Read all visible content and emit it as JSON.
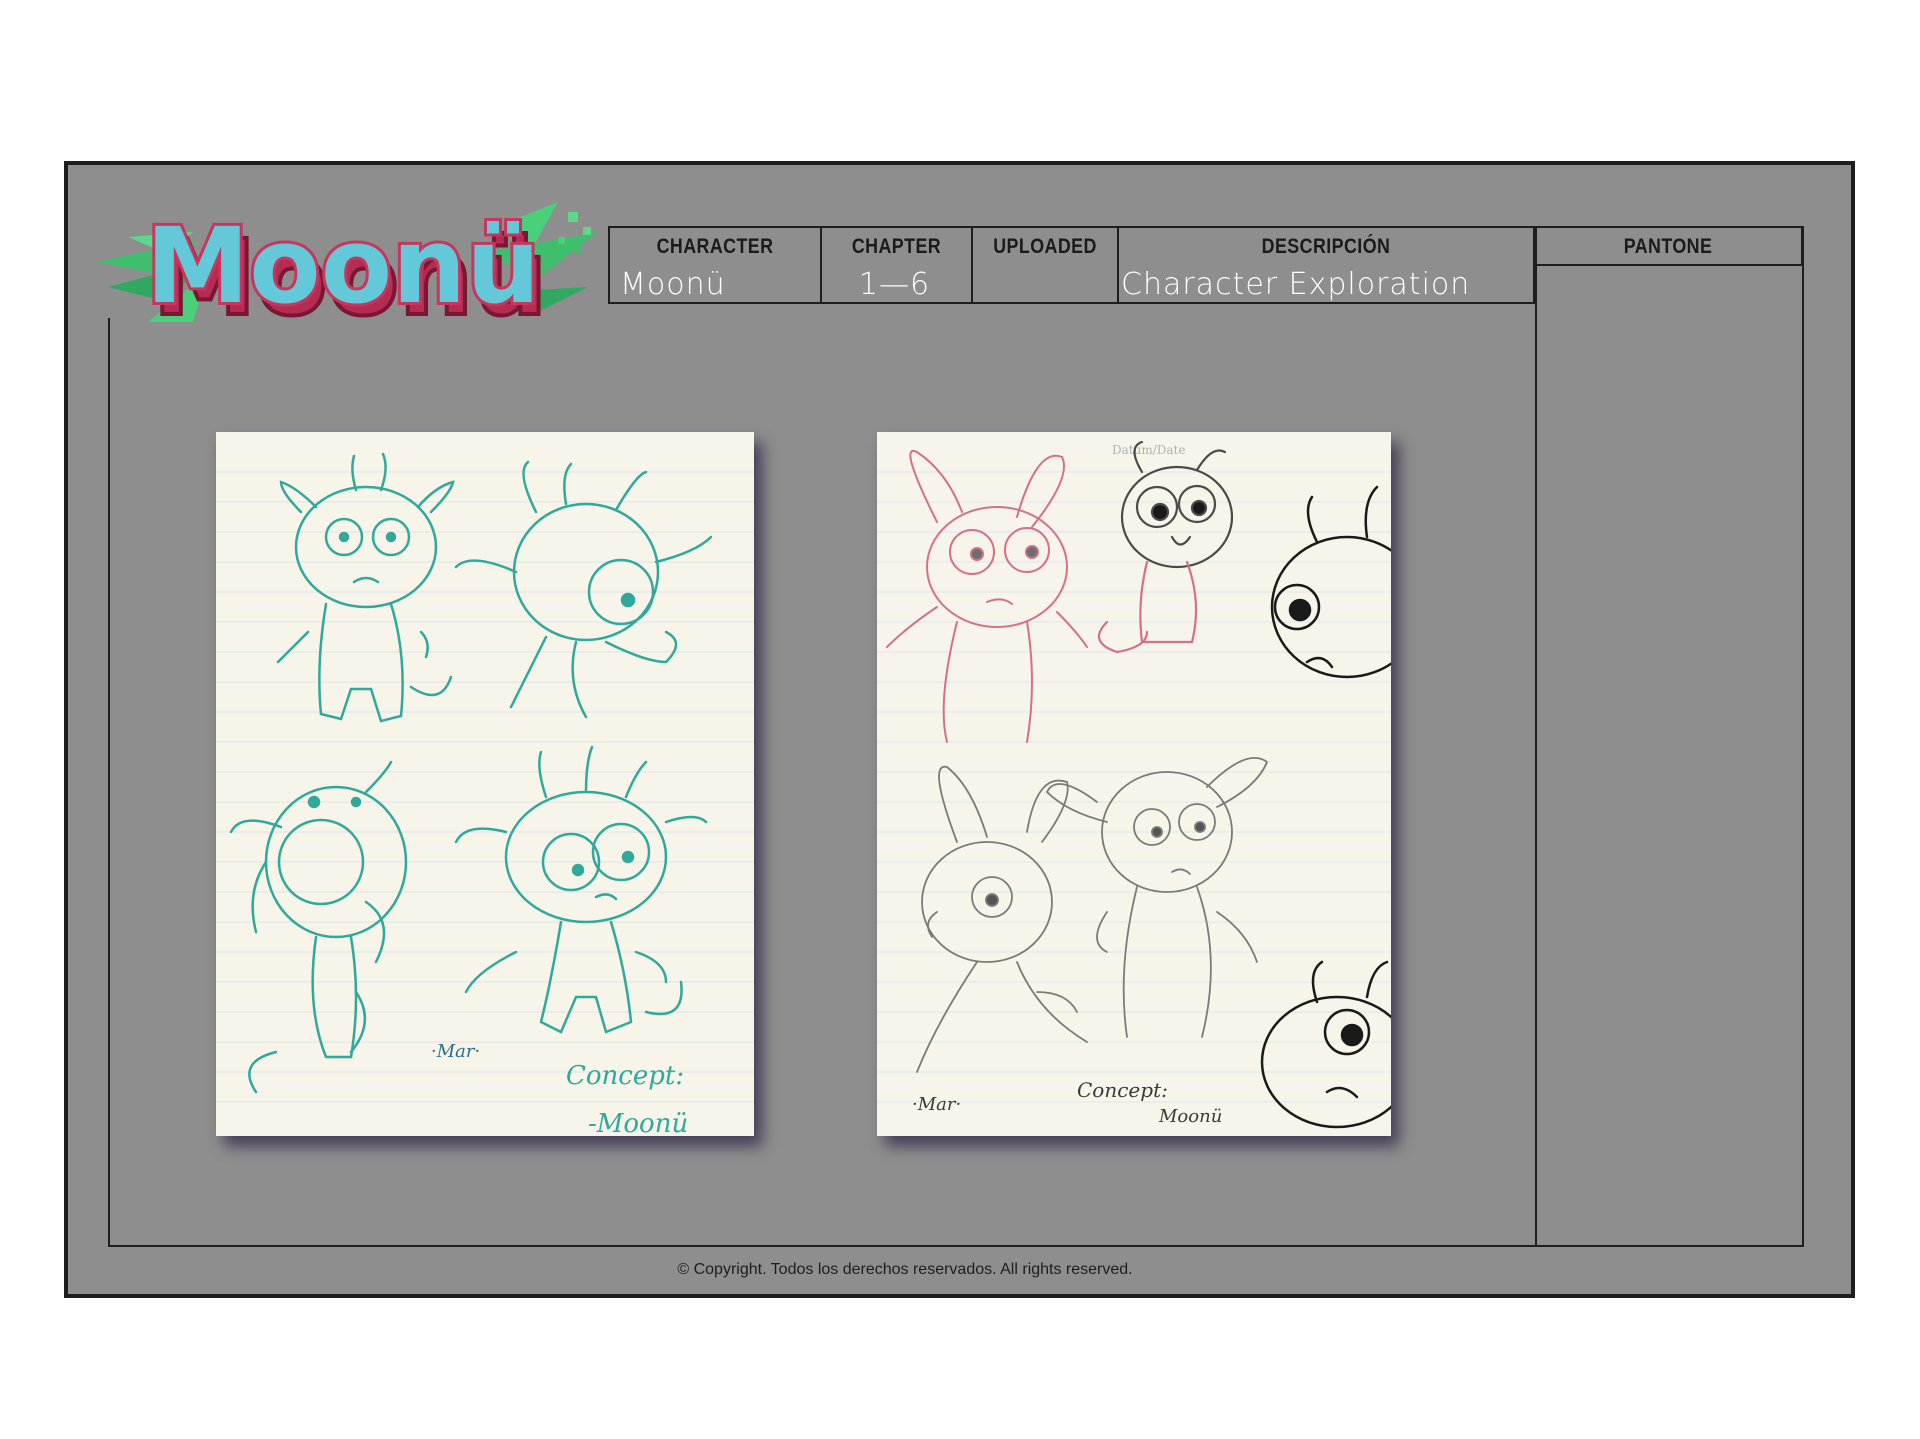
{
  "logo": {
    "text": "Moonü"
  },
  "header": {
    "columns": [
      {
        "label": "CHARACTER",
        "value": "Moonü"
      },
      {
        "label": "CHAPTER",
        "value": "1—6"
      },
      {
        "label": "UPLOADED",
        "value": ""
      },
      {
        "label": "DESCRIPCIÓN",
        "value": "Character Exploration"
      },
      {
        "label": "PANTONE",
        "value": ""
      }
    ]
  },
  "sketch_left": {
    "signature": "·Mar·",
    "concept_label": "Concept:",
    "concept_name": "-Moonü",
    "ink_color": "#2ea99a"
  },
  "sketch_right": {
    "date_label": "Datum/Date",
    "signature": "·Mar·",
    "concept_label": "Concept:",
    "concept_name": "Moonü",
    "pencil_color": "#6e6e6e",
    "pink_color": "#d4708a"
  },
  "footer": {
    "copyright": "© Copyright. Todos los derechos reservados. All rights reserved."
  },
  "colors": {
    "sheet": "#8e8e8e",
    "lines": "#1e1e1e",
    "logo_fill": "#63c9d8",
    "logo_outline": "#c8355d",
    "leaf": "#3fbf6e"
  }
}
